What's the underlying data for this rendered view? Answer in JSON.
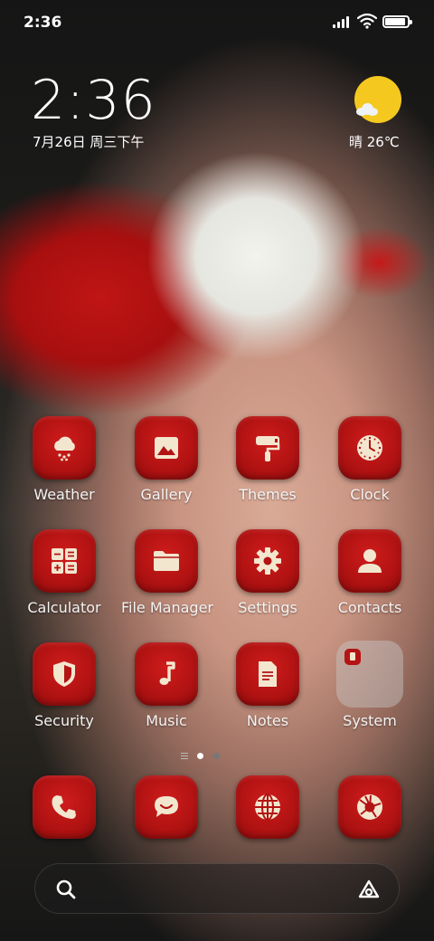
{
  "status_bar": {
    "time": "2:36",
    "battery_percent": 90
  },
  "lockscreen": {
    "clock": "2:36",
    "date": "7月26日 周三下午"
  },
  "weather_widget": {
    "text": "晴 26℃",
    "icon": "sunny-partly-cloudy-icon"
  },
  "colors": {
    "tile_red": "#b81515",
    "sun": "#f4c81f",
    "text": "#ffffff"
  },
  "apps": [
    {
      "label": "Weather",
      "icon": "weather-icon"
    },
    {
      "label": "Gallery",
      "icon": "gallery-icon"
    },
    {
      "label": "Themes",
      "icon": "themes-icon"
    },
    {
      "label": "Clock",
      "icon": "clock-icon"
    },
    {
      "label": "Calculator",
      "icon": "calculator-icon"
    },
    {
      "label": "File Manager",
      "icon": "folder-icon"
    },
    {
      "label": "Settings",
      "icon": "gear-icon"
    },
    {
      "label": "Contacts",
      "icon": "contacts-icon"
    },
    {
      "label": "Security",
      "icon": "shield-icon"
    },
    {
      "label": "Music",
      "icon": "music-note-icon"
    },
    {
      "label": "Notes",
      "icon": "notes-icon"
    },
    {
      "label": "System",
      "icon": "folder-preview"
    }
  ],
  "page_indicator": {
    "pages": 2,
    "current": 1
  },
  "dock": [
    {
      "icon": "phone-icon"
    },
    {
      "icon": "messages-icon"
    },
    {
      "icon": "browser-globe-icon"
    },
    {
      "icon": "camera-shutter-icon"
    }
  ],
  "search_bar": {
    "left_icon": "search-icon",
    "right_icon": "assistant-icon"
  }
}
